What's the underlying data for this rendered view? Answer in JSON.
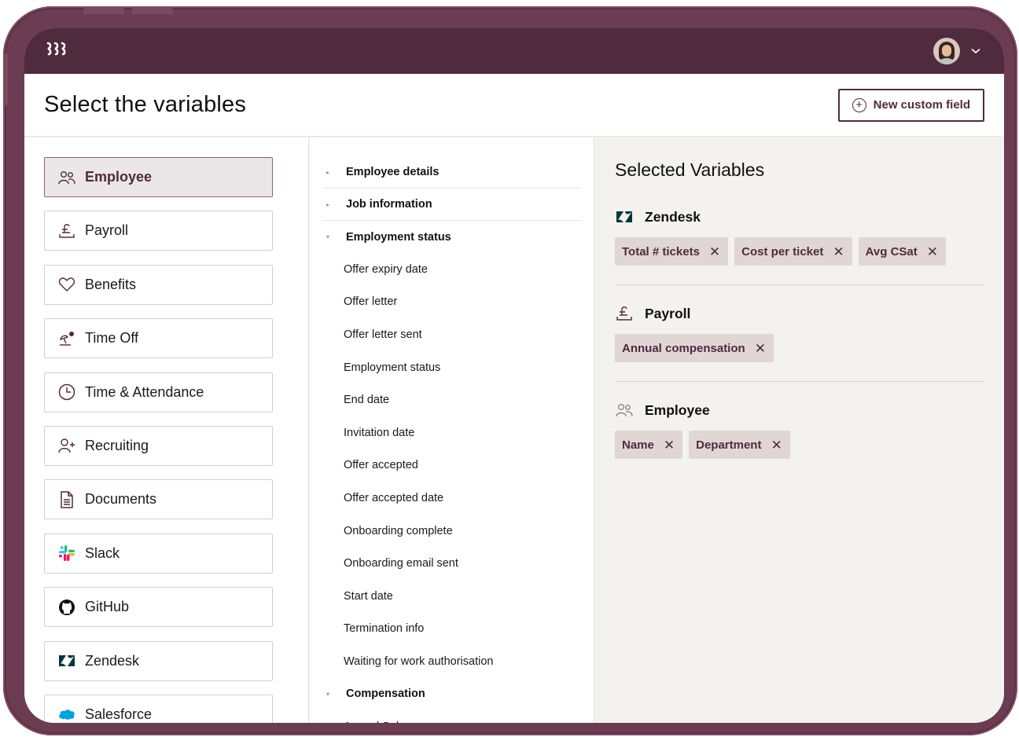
{
  "app": {
    "logo_text": "ꭆꭆꭆ",
    "user_menu_chevron": "⌄"
  },
  "header": {
    "title": "Select the variables",
    "new_field_label": "New custom field",
    "new_field_icon": "+"
  },
  "categories": [
    {
      "label": "Employee",
      "icon": "people-icon",
      "active": true
    },
    {
      "label": "Payroll",
      "icon": "pound-icon"
    },
    {
      "label": "Benefits",
      "icon": "heart-icon"
    },
    {
      "label": "Time Off",
      "icon": "beach-umbrella-icon"
    },
    {
      "label": "Time & Attendance",
      "icon": "clock-icon"
    },
    {
      "label": "Recruiting",
      "icon": "person-add-icon"
    },
    {
      "label": "Documents",
      "icon": "document-icon"
    },
    {
      "label": "Slack",
      "icon": "slack-icon"
    },
    {
      "label": "GitHub",
      "icon": "github-icon"
    },
    {
      "label": "Zendesk",
      "icon": "zendesk-icon"
    },
    {
      "label": "Salesforce",
      "icon": "salesforce-icon"
    }
  ],
  "fields": {
    "groups": [
      {
        "label": "Employee details",
        "expanded": false
      },
      {
        "label": "Job information",
        "expanded": false
      },
      {
        "label": "Employment status",
        "expanded": true
      },
      {
        "label": "Compensation",
        "expanded": true
      }
    ],
    "employment_status_items": [
      "Offer expiry date",
      "Offer letter",
      "Offer letter sent",
      "Employment status",
      "End date",
      "Invitation date",
      "Offer accepted",
      "Offer accepted date",
      "Onboarding complete",
      "Onboarding email sent",
      "Start date",
      "Termination info",
      "Waiting for work authorisation"
    ],
    "compensation_items": [
      "Annual Salary"
    ],
    "collapsed_glyph": "▸",
    "expanded_glyph": "▾"
  },
  "selected": {
    "title": "Selected Variables",
    "remove_glyph": "✕",
    "sections": [
      {
        "name": "Zendesk",
        "icon": "zendesk-icon",
        "chips": [
          "Total # tickets",
          "Cost per ticket",
          "Avg CSat"
        ]
      },
      {
        "name": "Payroll",
        "icon": "pound-icon",
        "chips": [
          "Annual compensation"
        ]
      },
      {
        "name": "Employee",
        "icon": "people-icon",
        "chips": [
          "Name",
          "Department"
        ]
      }
    ]
  },
  "colors": {
    "brand": "#4f2b3d",
    "frame": "#6b3c52",
    "chip_bg": "#e0d6d6",
    "panel_bg": "#f4f2ee",
    "active_bg": "#ebe6e7"
  }
}
